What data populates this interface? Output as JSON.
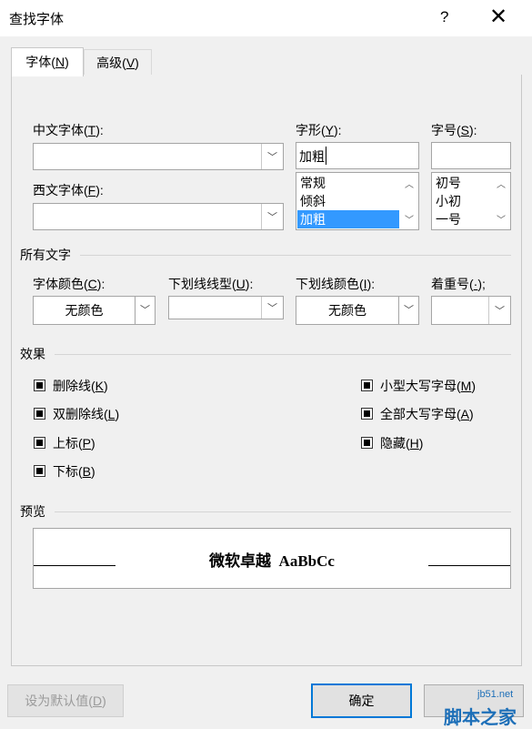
{
  "window": {
    "title": "查找字体",
    "help_glyph": "?",
    "close_glyph": "✕"
  },
  "tabs": [
    {
      "text": "字体(",
      "key": "N",
      "end": ")",
      "active": true
    },
    {
      "text": "高级(",
      "key": "V",
      "end": ")",
      "active": false
    }
  ],
  "font": {
    "chinese_label": {
      "text": "中文字体(",
      "key": "T",
      "end": "):"
    },
    "western_label": {
      "text": "西文字体(",
      "key": "F",
      "end": "):"
    },
    "style_label": {
      "text": "字形(",
      "key": "Y",
      "end": "):"
    },
    "size_label": {
      "text": "字号(",
      "key": "S",
      "end": "):"
    },
    "chinese_value": "",
    "western_value": "",
    "style_value": "加粗",
    "size_value": "",
    "style_options": [
      "常规",
      "倾斜",
      "加粗"
    ],
    "style_selected_index": 2,
    "size_options": [
      "初号",
      "小初",
      "一号"
    ]
  },
  "all_text": {
    "section": "所有文字",
    "color_label": {
      "text": "字体颜色(",
      "key": "C",
      "end": "):"
    },
    "underline_style_label": {
      "text": "下划线线型(",
      "key": "U",
      "end": "):"
    },
    "underline_color_label": {
      "text": "下划线颜色(",
      "key": "I",
      "end": "):"
    },
    "emphasis_label": {
      "text": "着重号(",
      "key": "·",
      "end": ");"
    },
    "color_value": "无颜色",
    "underline_style_value": "",
    "underline_color_value": "无颜色",
    "emphasis_value": ""
  },
  "effects": {
    "section": "效果",
    "left": [
      {
        "text": "删除线(",
        "key": "K",
        "end": ")",
        "checked": true
      },
      {
        "text": "双删除线(",
        "key": "L",
        "end": ")",
        "checked": true
      },
      {
        "text": "上标(",
        "key": "P",
        "end": ")",
        "checked": true
      },
      {
        "text": "下标(",
        "key": "B",
        "end": ")",
        "checked": true
      }
    ],
    "right": [
      {
        "text": "小型大写字母(",
        "key": "M",
        "end": ")",
        "checked": true
      },
      {
        "text": "全部大写字母(",
        "key": "A",
        "end": ")",
        "checked": true
      },
      {
        "text": "隐藏(",
        "key": "H",
        "end": ")",
        "checked": true
      }
    ]
  },
  "preview": {
    "section": "预览",
    "sample_text": "微软卓越  AaBbCc"
  },
  "buttons": {
    "default": {
      "text": "设为默认值(",
      "key": "D",
      "end": ")"
    },
    "ok": "确定"
  },
  "watermark": {
    "site": "jb51.net",
    "name": "脚本之家"
  },
  "colors": {
    "selection": "#3399ff",
    "ok_border": "#0078d7",
    "watermark": "#1d6fb8"
  }
}
